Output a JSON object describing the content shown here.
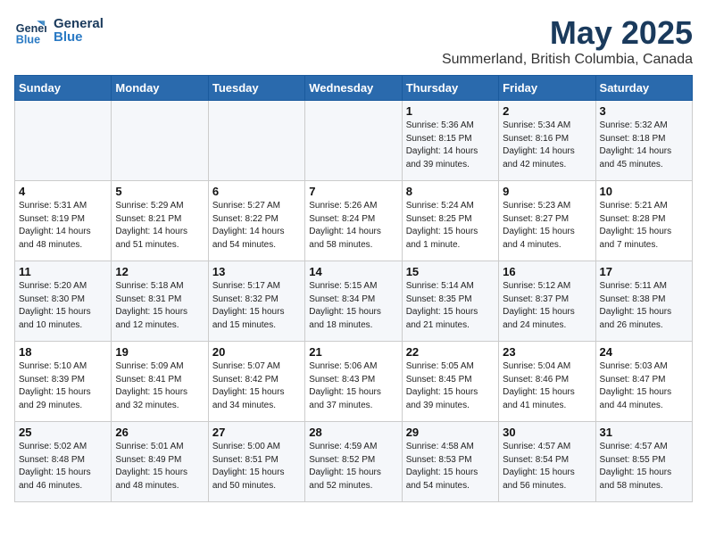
{
  "logo": {
    "line1": "General",
    "line2": "Blue"
  },
  "title": "May 2025",
  "subtitle": "Summerland, British Columbia, Canada",
  "days_of_week": [
    "Sunday",
    "Monday",
    "Tuesday",
    "Wednesday",
    "Thursday",
    "Friday",
    "Saturday"
  ],
  "weeks": [
    [
      {
        "day": "",
        "info": ""
      },
      {
        "day": "",
        "info": ""
      },
      {
        "day": "",
        "info": ""
      },
      {
        "day": "",
        "info": ""
      },
      {
        "day": "1",
        "info": "Sunrise: 5:36 AM\nSunset: 8:15 PM\nDaylight: 14 hours\nand 39 minutes."
      },
      {
        "day": "2",
        "info": "Sunrise: 5:34 AM\nSunset: 8:16 PM\nDaylight: 14 hours\nand 42 minutes."
      },
      {
        "day": "3",
        "info": "Sunrise: 5:32 AM\nSunset: 8:18 PM\nDaylight: 14 hours\nand 45 minutes."
      }
    ],
    [
      {
        "day": "4",
        "info": "Sunrise: 5:31 AM\nSunset: 8:19 PM\nDaylight: 14 hours\nand 48 minutes."
      },
      {
        "day": "5",
        "info": "Sunrise: 5:29 AM\nSunset: 8:21 PM\nDaylight: 14 hours\nand 51 minutes."
      },
      {
        "day": "6",
        "info": "Sunrise: 5:27 AM\nSunset: 8:22 PM\nDaylight: 14 hours\nand 54 minutes."
      },
      {
        "day": "7",
        "info": "Sunrise: 5:26 AM\nSunset: 8:24 PM\nDaylight: 14 hours\nand 58 minutes."
      },
      {
        "day": "8",
        "info": "Sunrise: 5:24 AM\nSunset: 8:25 PM\nDaylight: 15 hours\nand 1 minute."
      },
      {
        "day": "9",
        "info": "Sunrise: 5:23 AM\nSunset: 8:27 PM\nDaylight: 15 hours\nand 4 minutes."
      },
      {
        "day": "10",
        "info": "Sunrise: 5:21 AM\nSunset: 8:28 PM\nDaylight: 15 hours\nand 7 minutes."
      }
    ],
    [
      {
        "day": "11",
        "info": "Sunrise: 5:20 AM\nSunset: 8:30 PM\nDaylight: 15 hours\nand 10 minutes."
      },
      {
        "day": "12",
        "info": "Sunrise: 5:18 AM\nSunset: 8:31 PM\nDaylight: 15 hours\nand 12 minutes."
      },
      {
        "day": "13",
        "info": "Sunrise: 5:17 AM\nSunset: 8:32 PM\nDaylight: 15 hours\nand 15 minutes."
      },
      {
        "day": "14",
        "info": "Sunrise: 5:15 AM\nSunset: 8:34 PM\nDaylight: 15 hours\nand 18 minutes."
      },
      {
        "day": "15",
        "info": "Sunrise: 5:14 AM\nSunset: 8:35 PM\nDaylight: 15 hours\nand 21 minutes."
      },
      {
        "day": "16",
        "info": "Sunrise: 5:12 AM\nSunset: 8:37 PM\nDaylight: 15 hours\nand 24 minutes."
      },
      {
        "day": "17",
        "info": "Sunrise: 5:11 AM\nSunset: 8:38 PM\nDaylight: 15 hours\nand 26 minutes."
      }
    ],
    [
      {
        "day": "18",
        "info": "Sunrise: 5:10 AM\nSunset: 8:39 PM\nDaylight: 15 hours\nand 29 minutes."
      },
      {
        "day": "19",
        "info": "Sunrise: 5:09 AM\nSunset: 8:41 PM\nDaylight: 15 hours\nand 32 minutes."
      },
      {
        "day": "20",
        "info": "Sunrise: 5:07 AM\nSunset: 8:42 PM\nDaylight: 15 hours\nand 34 minutes."
      },
      {
        "day": "21",
        "info": "Sunrise: 5:06 AM\nSunset: 8:43 PM\nDaylight: 15 hours\nand 37 minutes."
      },
      {
        "day": "22",
        "info": "Sunrise: 5:05 AM\nSunset: 8:45 PM\nDaylight: 15 hours\nand 39 minutes."
      },
      {
        "day": "23",
        "info": "Sunrise: 5:04 AM\nSunset: 8:46 PM\nDaylight: 15 hours\nand 41 minutes."
      },
      {
        "day": "24",
        "info": "Sunrise: 5:03 AM\nSunset: 8:47 PM\nDaylight: 15 hours\nand 44 minutes."
      }
    ],
    [
      {
        "day": "25",
        "info": "Sunrise: 5:02 AM\nSunset: 8:48 PM\nDaylight: 15 hours\nand 46 minutes."
      },
      {
        "day": "26",
        "info": "Sunrise: 5:01 AM\nSunset: 8:49 PM\nDaylight: 15 hours\nand 48 minutes."
      },
      {
        "day": "27",
        "info": "Sunrise: 5:00 AM\nSunset: 8:51 PM\nDaylight: 15 hours\nand 50 minutes."
      },
      {
        "day": "28",
        "info": "Sunrise: 4:59 AM\nSunset: 8:52 PM\nDaylight: 15 hours\nand 52 minutes."
      },
      {
        "day": "29",
        "info": "Sunrise: 4:58 AM\nSunset: 8:53 PM\nDaylight: 15 hours\nand 54 minutes."
      },
      {
        "day": "30",
        "info": "Sunrise: 4:57 AM\nSunset: 8:54 PM\nDaylight: 15 hours\nand 56 minutes."
      },
      {
        "day": "31",
        "info": "Sunrise: 4:57 AM\nSunset: 8:55 PM\nDaylight: 15 hours\nand 58 minutes."
      }
    ]
  ]
}
